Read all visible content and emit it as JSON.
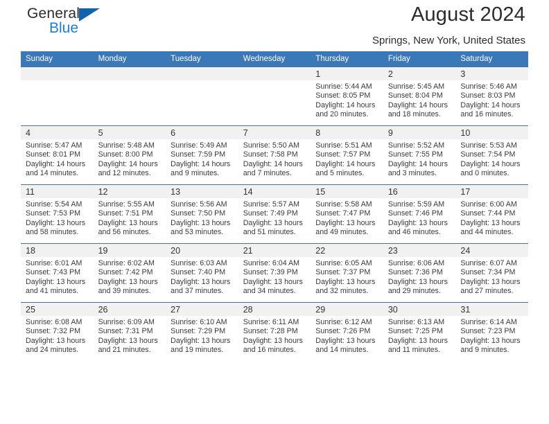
{
  "brand": {
    "name_top": "General",
    "name_bottom": "Blue",
    "accent_color": "#1b7fd4",
    "triangle_color": "#1263ad"
  },
  "header": {
    "title": "August 2024",
    "location": "Springs, New York, United States"
  },
  "theme": {
    "header_row_bg": "#3b78b7",
    "daynum_band_bg": "#f1f1f1",
    "row_divider": "#4a6f92",
    "text": "#333333"
  },
  "calendar": {
    "weekday_headers": [
      "Sunday",
      "Monday",
      "Tuesday",
      "Wednesday",
      "Thursday",
      "Friday",
      "Saturday"
    ],
    "labels": {
      "sunrise": "Sunrise:",
      "sunset": "Sunset:",
      "daylight": "Daylight:"
    },
    "weeks": [
      [
        {
          "day": "",
          "empty": true
        },
        {
          "day": "",
          "empty": true
        },
        {
          "day": "",
          "empty": true
        },
        {
          "day": "",
          "empty": true
        },
        {
          "day": "1",
          "sunrise": "Sunrise: 5:44 AM",
          "sunset": "Sunset: 8:05 PM",
          "daylight_1": "Daylight: 14 hours",
          "daylight_2": "and 20 minutes."
        },
        {
          "day": "2",
          "sunrise": "Sunrise: 5:45 AM",
          "sunset": "Sunset: 8:04 PM",
          "daylight_1": "Daylight: 14 hours",
          "daylight_2": "and 18 minutes."
        },
        {
          "day": "3",
          "sunrise": "Sunrise: 5:46 AM",
          "sunset": "Sunset: 8:03 PM",
          "daylight_1": "Daylight: 14 hours",
          "daylight_2": "and 16 minutes."
        }
      ],
      [
        {
          "day": "4",
          "sunrise": "Sunrise: 5:47 AM",
          "sunset": "Sunset: 8:01 PM",
          "daylight_1": "Daylight: 14 hours",
          "daylight_2": "and 14 minutes."
        },
        {
          "day": "5",
          "sunrise": "Sunrise: 5:48 AM",
          "sunset": "Sunset: 8:00 PM",
          "daylight_1": "Daylight: 14 hours",
          "daylight_2": "and 12 minutes."
        },
        {
          "day": "6",
          "sunrise": "Sunrise: 5:49 AM",
          "sunset": "Sunset: 7:59 PM",
          "daylight_1": "Daylight: 14 hours",
          "daylight_2": "and 9 minutes."
        },
        {
          "day": "7",
          "sunrise": "Sunrise: 5:50 AM",
          "sunset": "Sunset: 7:58 PM",
          "daylight_1": "Daylight: 14 hours",
          "daylight_2": "and 7 minutes."
        },
        {
          "day": "8",
          "sunrise": "Sunrise: 5:51 AM",
          "sunset": "Sunset: 7:57 PM",
          "daylight_1": "Daylight: 14 hours",
          "daylight_2": "and 5 minutes."
        },
        {
          "day": "9",
          "sunrise": "Sunrise: 5:52 AM",
          "sunset": "Sunset: 7:55 PM",
          "daylight_1": "Daylight: 14 hours",
          "daylight_2": "and 3 minutes."
        },
        {
          "day": "10",
          "sunrise": "Sunrise: 5:53 AM",
          "sunset": "Sunset: 7:54 PM",
          "daylight_1": "Daylight: 14 hours",
          "daylight_2": "and 0 minutes."
        }
      ],
      [
        {
          "day": "11",
          "sunrise": "Sunrise: 5:54 AM",
          "sunset": "Sunset: 7:53 PM",
          "daylight_1": "Daylight: 13 hours",
          "daylight_2": "and 58 minutes."
        },
        {
          "day": "12",
          "sunrise": "Sunrise: 5:55 AM",
          "sunset": "Sunset: 7:51 PM",
          "daylight_1": "Daylight: 13 hours",
          "daylight_2": "and 56 minutes."
        },
        {
          "day": "13",
          "sunrise": "Sunrise: 5:56 AM",
          "sunset": "Sunset: 7:50 PM",
          "daylight_1": "Daylight: 13 hours",
          "daylight_2": "and 53 minutes."
        },
        {
          "day": "14",
          "sunrise": "Sunrise: 5:57 AM",
          "sunset": "Sunset: 7:49 PM",
          "daylight_1": "Daylight: 13 hours",
          "daylight_2": "and 51 minutes."
        },
        {
          "day": "15",
          "sunrise": "Sunrise: 5:58 AM",
          "sunset": "Sunset: 7:47 PM",
          "daylight_1": "Daylight: 13 hours",
          "daylight_2": "and 49 minutes."
        },
        {
          "day": "16",
          "sunrise": "Sunrise: 5:59 AM",
          "sunset": "Sunset: 7:46 PM",
          "daylight_1": "Daylight: 13 hours",
          "daylight_2": "and 46 minutes."
        },
        {
          "day": "17",
          "sunrise": "Sunrise: 6:00 AM",
          "sunset": "Sunset: 7:44 PM",
          "daylight_1": "Daylight: 13 hours",
          "daylight_2": "and 44 minutes."
        }
      ],
      [
        {
          "day": "18",
          "sunrise": "Sunrise: 6:01 AM",
          "sunset": "Sunset: 7:43 PM",
          "daylight_1": "Daylight: 13 hours",
          "daylight_2": "and 41 minutes."
        },
        {
          "day": "19",
          "sunrise": "Sunrise: 6:02 AM",
          "sunset": "Sunset: 7:42 PM",
          "daylight_1": "Daylight: 13 hours",
          "daylight_2": "and 39 minutes."
        },
        {
          "day": "20",
          "sunrise": "Sunrise: 6:03 AM",
          "sunset": "Sunset: 7:40 PM",
          "daylight_1": "Daylight: 13 hours",
          "daylight_2": "and 37 minutes."
        },
        {
          "day": "21",
          "sunrise": "Sunrise: 6:04 AM",
          "sunset": "Sunset: 7:39 PM",
          "daylight_1": "Daylight: 13 hours",
          "daylight_2": "and 34 minutes."
        },
        {
          "day": "22",
          "sunrise": "Sunrise: 6:05 AM",
          "sunset": "Sunset: 7:37 PM",
          "daylight_1": "Daylight: 13 hours",
          "daylight_2": "and 32 minutes."
        },
        {
          "day": "23",
          "sunrise": "Sunrise: 6:06 AM",
          "sunset": "Sunset: 7:36 PM",
          "daylight_1": "Daylight: 13 hours",
          "daylight_2": "and 29 minutes."
        },
        {
          "day": "24",
          "sunrise": "Sunrise: 6:07 AM",
          "sunset": "Sunset: 7:34 PM",
          "daylight_1": "Daylight: 13 hours",
          "daylight_2": "and 27 minutes."
        }
      ],
      [
        {
          "day": "25",
          "sunrise": "Sunrise: 6:08 AM",
          "sunset": "Sunset: 7:32 PM",
          "daylight_1": "Daylight: 13 hours",
          "daylight_2": "and 24 minutes."
        },
        {
          "day": "26",
          "sunrise": "Sunrise: 6:09 AM",
          "sunset": "Sunset: 7:31 PM",
          "daylight_1": "Daylight: 13 hours",
          "daylight_2": "and 21 minutes."
        },
        {
          "day": "27",
          "sunrise": "Sunrise: 6:10 AM",
          "sunset": "Sunset: 7:29 PM",
          "daylight_1": "Daylight: 13 hours",
          "daylight_2": "and 19 minutes."
        },
        {
          "day": "28",
          "sunrise": "Sunrise: 6:11 AM",
          "sunset": "Sunset: 7:28 PM",
          "daylight_1": "Daylight: 13 hours",
          "daylight_2": "and 16 minutes."
        },
        {
          "day": "29",
          "sunrise": "Sunrise: 6:12 AM",
          "sunset": "Sunset: 7:26 PM",
          "daylight_1": "Daylight: 13 hours",
          "daylight_2": "and 14 minutes."
        },
        {
          "day": "30",
          "sunrise": "Sunrise: 6:13 AM",
          "sunset": "Sunset: 7:25 PM",
          "daylight_1": "Daylight: 13 hours",
          "daylight_2": "and 11 minutes."
        },
        {
          "day": "31",
          "sunrise": "Sunrise: 6:14 AM",
          "sunset": "Sunset: 7:23 PM",
          "daylight_1": "Daylight: 13 hours",
          "daylight_2": "and 9 minutes."
        }
      ]
    ]
  }
}
